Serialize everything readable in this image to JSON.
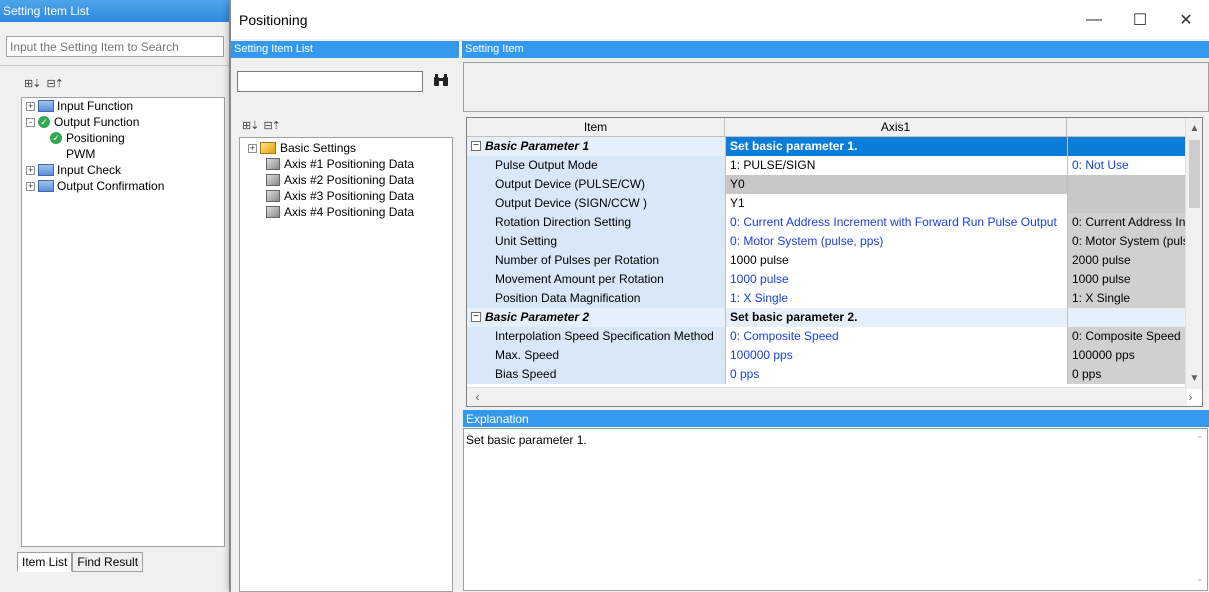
{
  "background_panel": {
    "title": "Setting Item List",
    "search_placeholder": "Input the Setting Item to Search",
    "tree": [
      {
        "label": "Input Function",
        "expander": "+"
      },
      {
        "label": "Output Function",
        "expander": "-"
      },
      {
        "label": "Positioning"
      },
      {
        "label": "PWM"
      },
      {
        "label": "Input Check",
        "expander": "+"
      },
      {
        "label": "Output Confirmation",
        "expander": "+"
      }
    ],
    "tabs": [
      "Item List",
      "Find Result"
    ]
  },
  "dialog": {
    "title": "Positioning",
    "window_buttons": {
      "minimize": "—",
      "maximize": "☐",
      "close": "✕"
    },
    "left_pane": {
      "header": "Setting Item List",
      "search_value": "",
      "find_icon": "binoculars-icon",
      "tree": [
        {
          "label": "Basic Settings",
          "expander": "+"
        },
        {
          "label": "Axis #1 Positioning Data"
        },
        {
          "label": "Axis #2 Positioning Data"
        },
        {
          "label": "Axis #3 Positioning Data"
        },
        {
          "label": "Axis #4 Positioning Data"
        }
      ]
    },
    "right_pane": {
      "header": "Setting Item",
      "columns": [
        "Item",
        "Axis1",
        ""
      ],
      "rows": [
        {
          "type": "section",
          "item": "Basic Parameter 1",
          "axis1": "Set basic parameter 1.",
          "axis2": ""
        },
        {
          "item": "Pulse Output Mode",
          "axis1": "1: PULSE/SIGN",
          "axis2": "0: Not Use"
        },
        {
          "item": "Output Device (PULSE/CW)",
          "axis1": "Y0",
          "axis2": ""
        },
        {
          "item": "Output Device (SIGN/CCW )",
          "axis1": "Y1",
          "axis2": ""
        },
        {
          "item": "Rotation Direction Setting",
          "axis1": "0: Current Address Increment with Forward Run Pulse Output",
          "axis2": "0: Current Address In"
        },
        {
          "item": "Unit Setting",
          "axis1": "0: Motor System (pulse, pps)",
          "axis2": "0: Motor System (puls"
        },
        {
          "item": "Number of Pulses per Rotation",
          "axis1": "1000 pulse",
          "axis2": "2000 pulse"
        },
        {
          "item": "Movement Amount per Rotation",
          "axis1": "1000 pulse",
          "axis2": "1000 pulse"
        },
        {
          "item": "Position Data Magnification",
          "axis1": "1: X Single",
          "axis2": "1: X Single"
        },
        {
          "type": "section",
          "item": "Basic Parameter 2",
          "axis1": "Set basic parameter 2.",
          "axis2": ""
        },
        {
          "item": "Interpolation Speed Specification Method",
          "axis1": "0: Composite Speed",
          "axis2": "0: Composite Speed"
        },
        {
          "item": "Max. Speed",
          "axis1": "100000 pps",
          "axis2": "100000 pps"
        },
        {
          "item": "Bias Speed",
          "axis1": "0 pps",
          "axis2": "0 pps"
        }
      ],
      "explanation_header": "Explanation",
      "explanation_text": "Set basic parameter 1."
    }
  }
}
